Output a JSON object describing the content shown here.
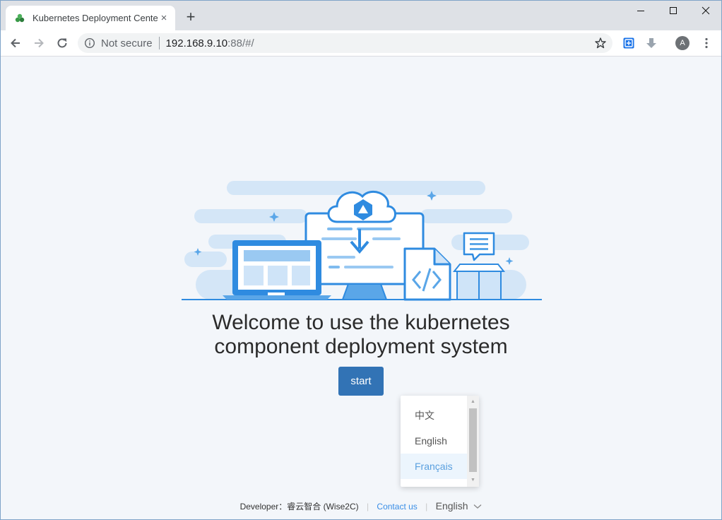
{
  "browser": {
    "tab_title": "Kubernetes Deployment Cente",
    "tab_close": "×",
    "new_tab": "+",
    "address": {
      "security_label": "Not secure",
      "url_host": "192.168.9.10",
      "url_rest": ":88/#/"
    },
    "profile_initial": "A"
  },
  "page": {
    "welcome_line1": "Welcome to use the kubernetes",
    "welcome_line2": "component deployment system",
    "start_label": "start",
    "language_options": [
      "中文",
      "English",
      "Français"
    ],
    "highlighted_option": "Français",
    "footer": {
      "developer": "Developer：睿云智合 (Wise2C)",
      "contact": "Contact us",
      "language": "English"
    }
  },
  "colors": {
    "primary_button": "#3273b5",
    "link": "#3a8ee6",
    "page_bg": "#f3f6fa",
    "illustration_blue": "#2f8be0"
  }
}
